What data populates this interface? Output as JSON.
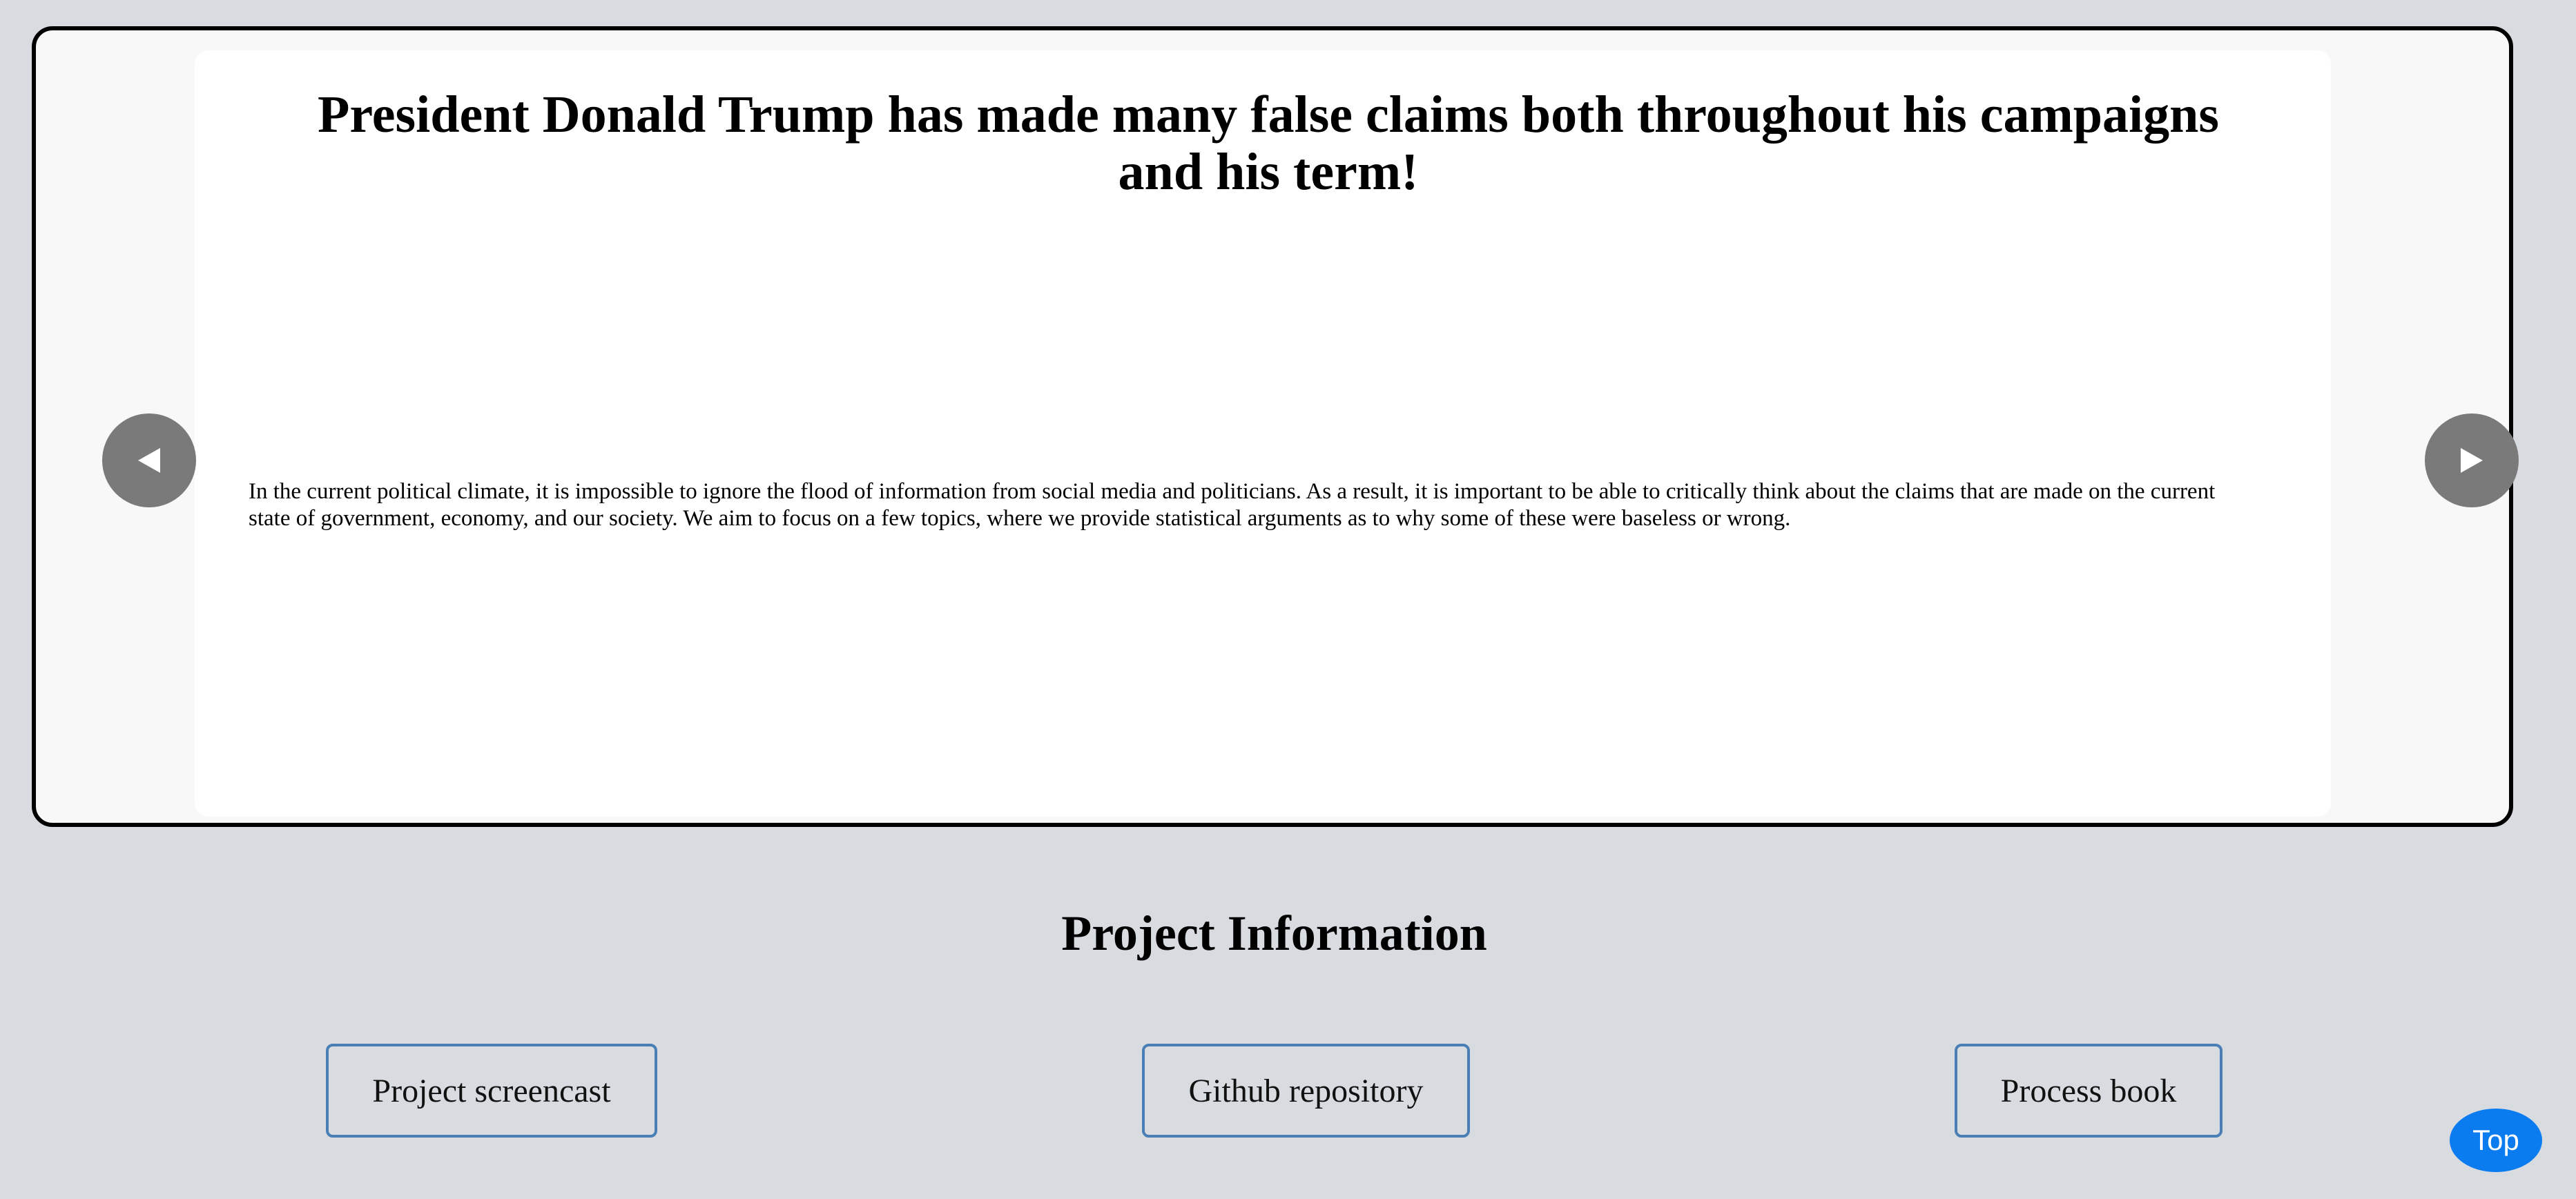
{
  "carousel": {
    "slide": {
      "title": "President Donald Trump has made many false claims both throughout his campaigns and his term!",
      "body": "In the current political climate, it is impossible to ignore the flood of information from social media and politicians. As a result, it is important to be able to critically think about the claims that are made on the current state of government, economy, and our society. We aim to focus on a few topics, where we provide statistical arguments as to why some of these were baseless or wrong."
    },
    "prev_icon": "triangle-left-icon",
    "next_icon": "triangle-right-icon"
  },
  "project_info": {
    "title": "Project Information",
    "buttons": [
      {
        "label": "Project screencast"
      },
      {
        "label": "Github repository"
      },
      {
        "label": "Process book"
      }
    ]
  },
  "top_button": {
    "label": "Top"
  },
  "colors": {
    "page_background": "#d8dbe0",
    "frame_background": "#f8f8f8",
    "arrow_background": "#7a7a7a",
    "button_border": "#4a7fb5",
    "top_button": "#0b7cf0"
  }
}
